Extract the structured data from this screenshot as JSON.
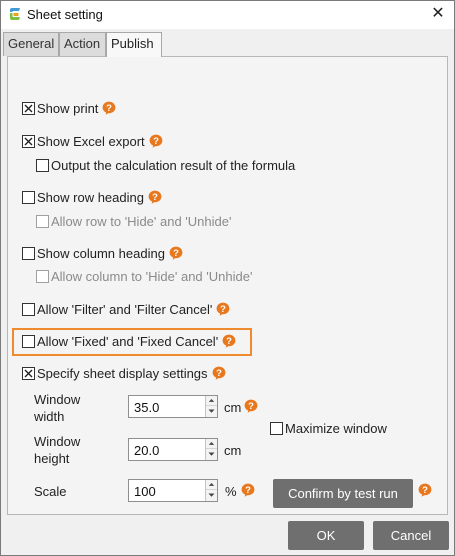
{
  "window": {
    "title": "Sheet setting",
    "close_glyph": "✕"
  },
  "tabs": [
    {
      "label": "General"
    },
    {
      "label": "Action"
    },
    {
      "label": "Publish",
      "active": true
    }
  ],
  "options": {
    "show_print": {
      "label": "Show print",
      "checked": true
    },
    "show_excel_export": {
      "label": "Show Excel export",
      "checked": true
    },
    "output_calc_result": {
      "label": "Output the calculation result of the formula",
      "checked": false
    },
    "show_row_heading": {
      "label": "Show row heading",
      "checked": false
    },
    "allow_row_hide": {
      "label": "Allow row to 'Hide' and 'Unhide'",
      "checked": false,
      "disabled": true
    },
    "show_column_heading": {
      "label": "Show column heading",
      "checked": false
    },
    "allow_column_hide": {
      "label": "Allow column to 'Hide' and 'Unhide'",
      "checked": false,
      "disabled": true
    },
    "allow_filter": {
      "label": "Allow 'Filter' and 'Filter Cancel'",
      "checked": false
    },
    "allow_fixed": {
      "label": "Allow 'Fixed' and 'Fixed Cancel'",
      "checked": false
    },
    "specify_display": {
      "label": "Specify sheet display settings",
      "checked": true
    }
  },
  "display_settings": {
    "window_width": {
      "label_line1": "Window",
      "label_line2": "width",
      "value": "35.0",
      "unit": "cm"
    },
    "window_height": {
      "label_line1": "Window",
      "label_line2": "height",
      "value": "20.0",
      "unit": "cm"
    },
    "scale": {
      "label": "Scale",
      "value": "100",
      "unit": "%"
    },
    "maximize_window": {
      "label": "Maximize window",
      "checked": false
    },
    "confirm_button": "Confirm by test run"
  },
  "footer": {
    "ok": "OK",
    "cancel": "Cancel"
  },
  "colors": {
    "accent_orange": "#ef8a2e",
    "help_icon": "#e8781e",
    "button_gray": "#6f6f6f",
    "panel_bg": "#f4f4f4"
  },
  "icons": [
    "app-logo-icon",
    "close-icon",
    "help-icon",
    "checkbox-checked-icon",
    "spin-up-icon",
    "spin-down-icon"
  ]
}
